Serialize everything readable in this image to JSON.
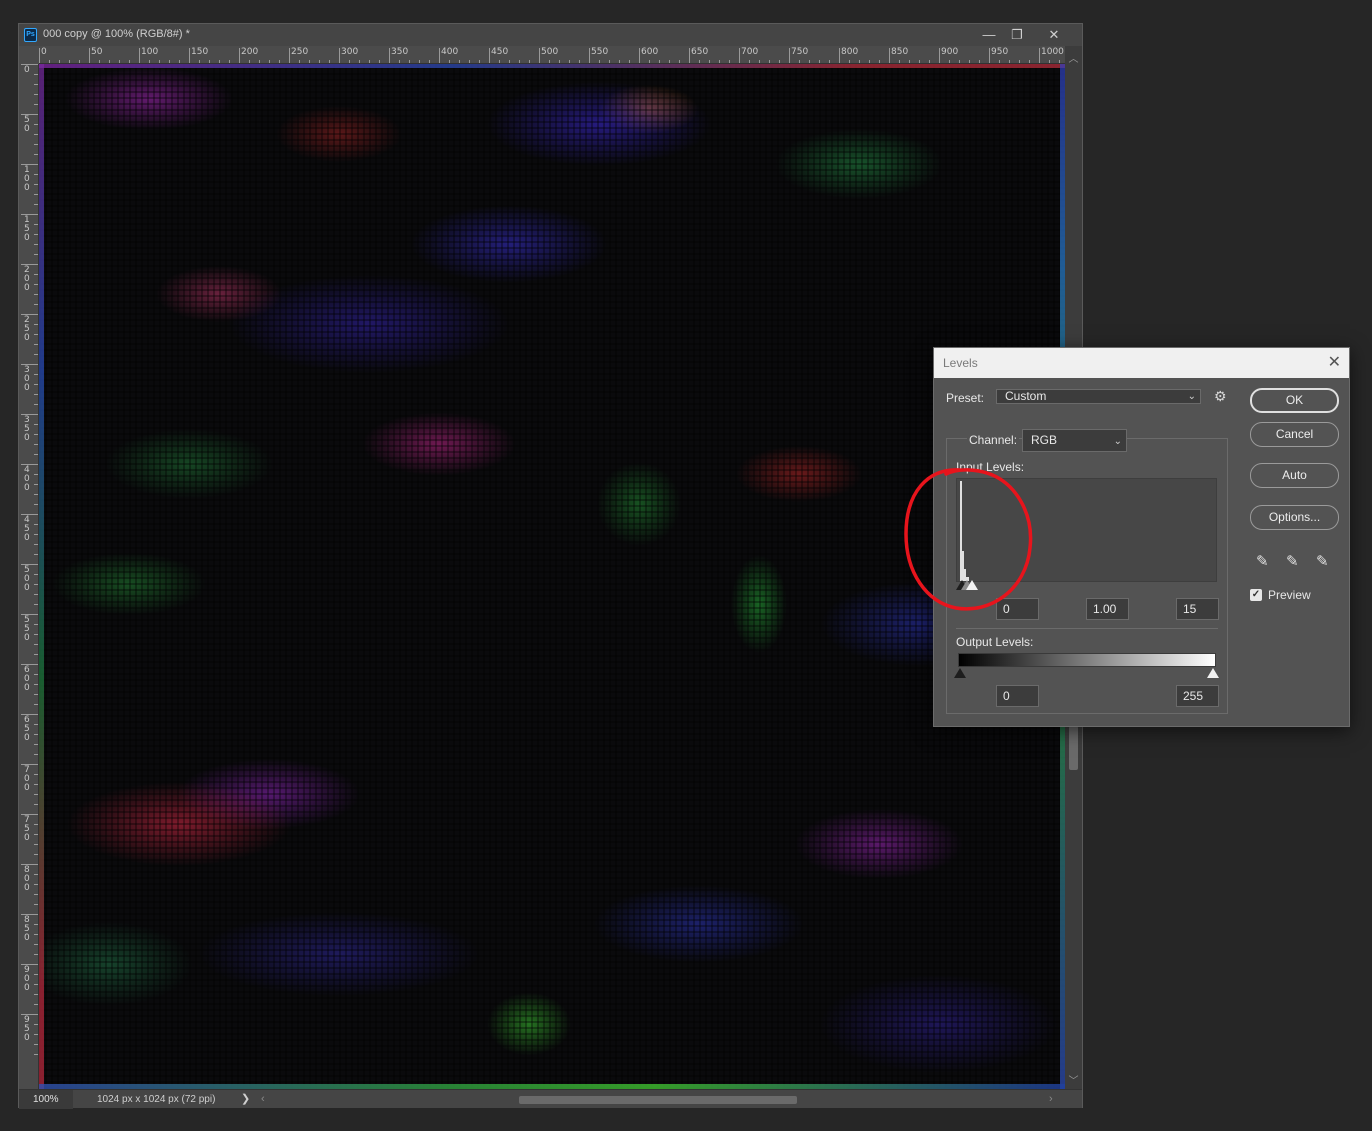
{
  "document": {
    "title": "000 copy @ 100% (RGB/8#) *",
    "app_badge": "Ps",
    "window_buttons": {
      "minimize": "—",
      "restore": "❐",
      "close": "✕"
    },
    "ruler_top_labels": [
      "0",
      "50",
      "100",
      "150",
      "200",
      "250",
      "300",
      "350",
      "400",
      "450",
      "500",
      "550",
      "600",
      "650",
      "700",
      "750",
      "800",
      "850",
      "900",
      "950",
      "1000"
    ],
    "ruler_left_labels": [
      "0",
      "50",
      "100",
      "150",
      "200",
      "250",
      "300",
      "350",
      "400",
      "450",
      "500",
      "550",
      "600",
      "650",
      "700",
      "750",
      "800",
      "850",
      "900",
      "950"
    ],
    "zoom": "100%",
    "doc_info": "1024 px x 1024 px (72 ppi)",
    "status_arrow": "❯",
    "canvas_image": "noisy multicolor abstract pattern (red, green, blue, magenta streaks on dark background)"
  },
  "levels": {
    "title": "Levels",
    "close_glyph": "✕",
    "preset_label": "Preset:",
    "preset_value": "Custom",
    "channel_label": "Channel:",
    "channel_value": "RGB",
    "input_levels_label": "Input Levels:",
    "input_black": "0",
    "input_gamma": "1.00",
    "input_white": "15",
    "output_levels_label": "Output Levels:",
    "output_black": "0",
    "output_white": "255",
    "buttons": {
      "ok": "OK",
      "cancel": "Cancel",
      "auto": "Auto",
      "options": "Options..."
    },
    "preview_label": "Preview",
    "preview_checked": true,
    "gear_glyph": "⚙",
    "eyedropper_glyph": "✎",
    "chevron_glyph": "⌄"
  },
  "colors": {
    "annotation": "#e8141c",
    "workspace": "#262626",
    "dialog": "#535353"
  }
}
